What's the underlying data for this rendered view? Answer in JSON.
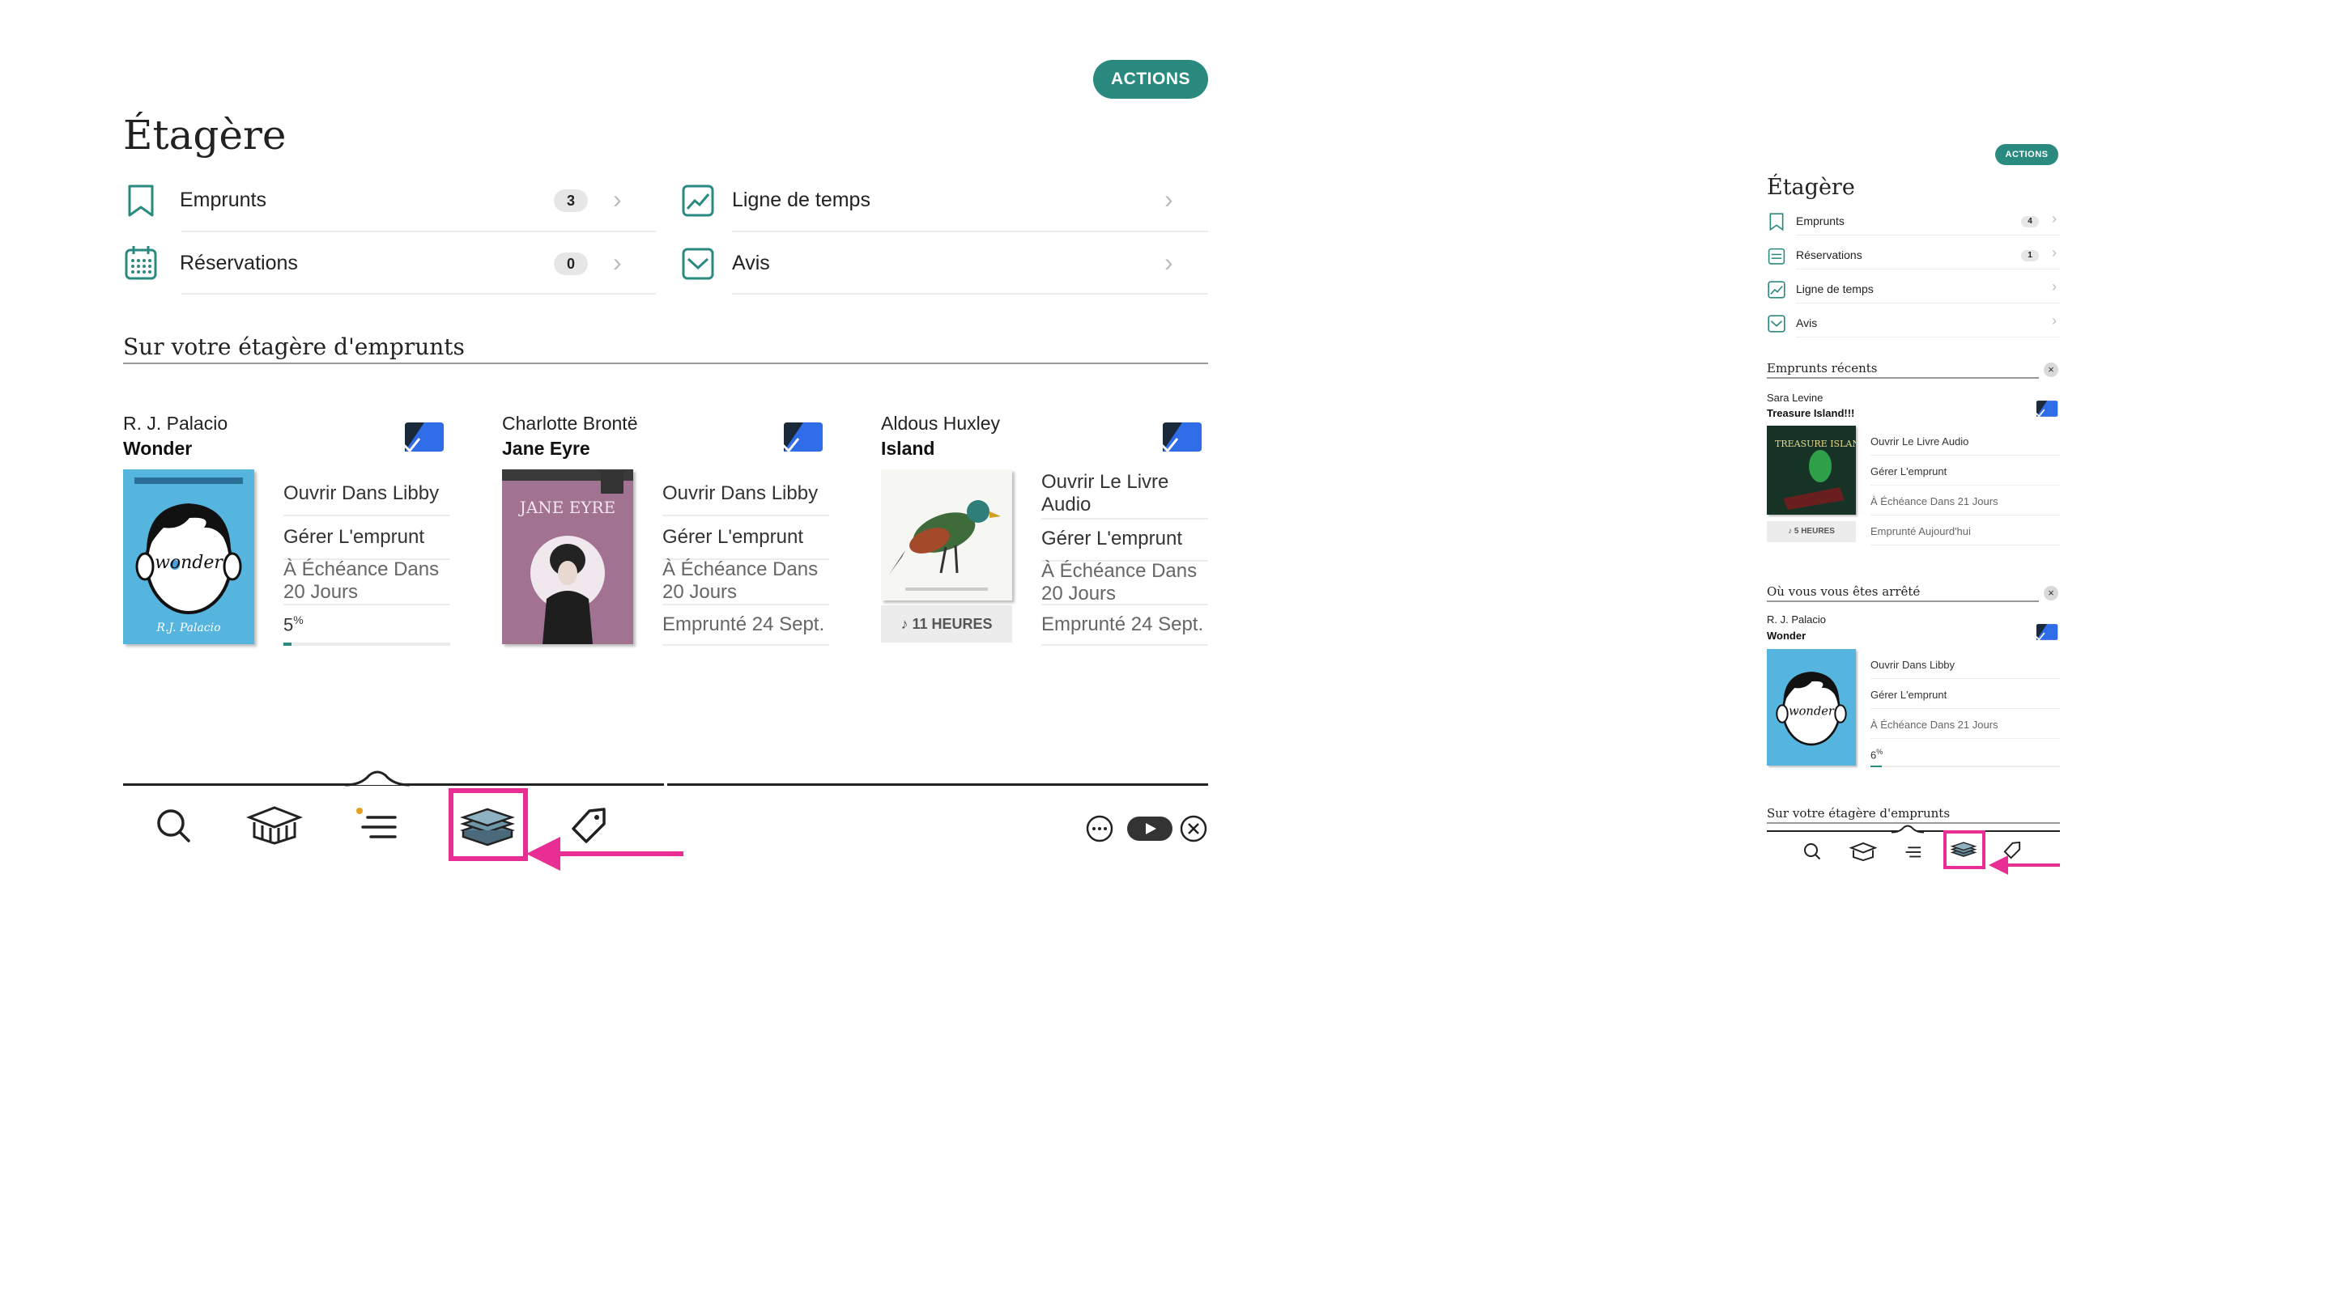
{
  "large": {
    "actions_label": "ACTIONS",
    "title": "Étagère",
    "menu": [
      {
        "label": "Emprunts",
        "count": "3",
        "icon": "bookmark-icon"
      },
      {
        "label": "Ligne de temps",
        "count": "",
        "icon": "timeline-icon"
      },
      {
        "label": "Réservations",
        "count": "0",
        "icon": "calendar-icon"
      },
      {
        "label": "Avis",
        "count": "",
        "icon": "envelope-icon"
      }
    ],
    "section_title": "Sur votre étagère d'emprunts",
    "books": [
      {
        "author": "R. J. Palacio",
        "title": "Wonder",
        "actions": [
          "Ouvrir Dans Libby",
          "Gérer L'emprunt",
          "À Échéance Dans 20 Jours"
        ],
        "progress_label": "5",
        "progress_unit": "%",
        "progress": 0.05
      },
      {
        "author": "Charlotte Brontë",
        "title": "Jane Eyre",
        "actions": [
          "Ouvrir Dans Libby",
          "Gérer L'emprunt",
          "À Échéance Dans 20 Jours",
          "Emprunté 24 Sept."
        ],
        "cover_text": "JANE EYRE"
      },
      {
        "author": "Aldous Huxley",
        "title": "Island",
        "actions": [
          "Ouvrir Le Livre Audio",
          "Gérer L'emprunt",
          "À Échéance Dans 20 Jours",
          "Emprunté 24 Sept."
        ],
        "duration": "11 HEURES"
      }
    ]
  },
  "small": {
    "actions_label": "ACTIONS",
    "title": "Étagère",
    "menu": [
      {
        "label": "Emprunts",
        "count": "4"
      },
      {
        "label": "Réservations",
        "count": "1"
      },
      {
        "label": "Ligne de temps",
        "count": ""
      },
      {
        "label": "Avis",
        "count": ""
      }
    ],
    "recent": {
      "section_title": "Emprunts récents",
      "close": "×",
      "author": "Sara Levine",
      "title": "Treasure Island!!!",
      "actions": [
        "Ouvrir Le Livre Audio",
        "Gérer L'emprunt",
        "À Échéance Dans 21 Jours",
        "Emprunté Aujourd'hui"
      ],
      "duration": "5 HEURES",
      "cover_text": "TREASURE ISLAND!!!"
    },
    "stopped": {
      "section_title": "Où vous vous êtes arrêté",
      "close": "×",
      "author": "R. J. Palacio",
      "title": "Wonder",
      "actions": [
        "Ouvrir Dans Libby",
        "Gérer L'emprunt",
        "À Échéance Dans 21 Jours"
      ],
      "progress_label": "6",
      "progress_unit": "%"
    },
    "bottom_section": "Sur votre étagère d'emprunts"
  },
  "colors": {
    "teal": "#2a8a80",
    "highlight": "#e82d93",
    "blue": "#2f6ce8"
  }
}
